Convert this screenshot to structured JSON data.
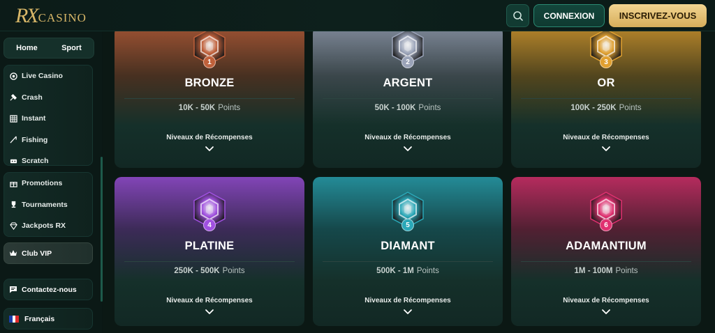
{
  "header": {
    "logo_rx": "RX",
    "logo_casino": "CASINO",
    "search_icon": "search-icon",
    "login_label": "CONNEXION",
    "signup_label": "INSCRIVEZ-VOUS"
  },
  "sidebar": {
    "tabs": [
      "Home",
      "Sport"
    ],
    "games": [
      {
        "label": "Live Casino",
        "icon": "live-casino-icon"
      },
      {
        "label": "Crash",
        "icon": "crash-icon"
      },
      {
        "label": "Instant",
        "icon": "instant-icon"
      },
      {
        "label": "Fishing",
        "icon": "fishing-icon"
      },
      {
        "label": "Scratch",
        "icon": "scratch-icon"
      }
    ],
    "promos": [
      {
        "label": "Promotions",
        "icon": "gift-icon"
      },
      {
        "label": "Tournaments",
        "icon": "trophy-icon"
      },
      {
        "label": "Jackpots RX",
        "icon": "diamond-icon"
      }
    ],
    "vip_label": "Club VIP",
    "contact_label": "Contactez-nous",
    "language_label": "Français"
  },
  "tiers": [
    {
      "name": "BRONZE",
      "rank": "1",
      "range": "10K - 50K",
      "unit": "Points",
      "rewards": "Niveaux de Récompenses",
      "color": "#c0603a"
    },
    {
      "name": "ARGENT",
      "rank": "2",
      "range": "50K - 100K",
      "unit": "Points",
      "rewards": "Niveaux de Récompenses",
      "color": "#9aa3b8"
    },
    {
      "name": "OR",
      "rank": "3",
      "range": "100K - 250K",
      "unit": "Points",
      "rewards": "Niveaux de Récompenses",
      "color": "#e0a030"
    },
    {
      "name": "PLATINE",
      "rank": "4",
      "range": "250K - 500K",
      "unit": "Points",
      "rewards": "Niveaux de Récompenses",
      "color": "#a050e0"
    },
    {
      "name": "DIAMANT",
      "rank": "5",
      "range": "500K - 1M",
      "unit": "Points",
      "rewards": "Niveaux de Récompenses",
      "color": "#2aa8b8"
    },
    {
      "name": "ADAMANTIUM",
      "rank": "6",
      "range": "1M - 100M",
      "unit": "Points",
      "rewards": "Niveaux de Récompenses",
      "color": "#e03070"
    }
  ]
}
